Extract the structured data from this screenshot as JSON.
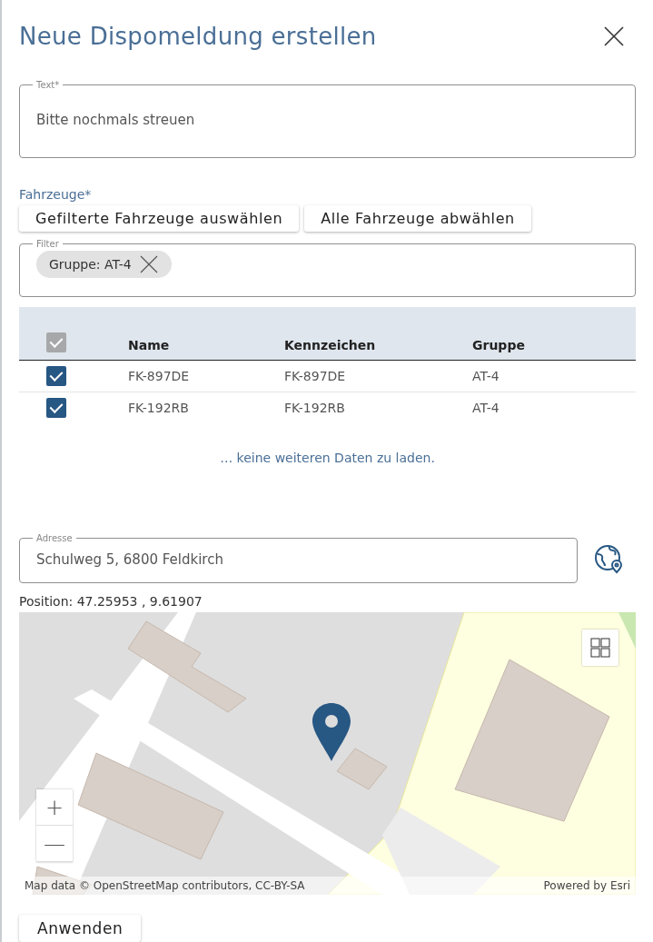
{
  "dialog": {
    "title": "Neue Dispomeldung erstellen"
  },
  "text_field": {
    "label": "Text*",
    "value": "Bitte nochmals streuen"
  },
  "vehicles": {
    "label": "Fahrzeuge*",
    "buttons": [
      "Gefilterte Fahrzeuge auswählen",
      "Alle Fahrzeuge abwählen"
    ]
  },
  "filter_field": {
    "label": "Filter",
    "chips": [
      "Gruppe: AT-4"
    ]
  },
  "table": {
    "header_checkbox": {
      "checked": true,
      "disabled": true
    },
    "columns": [
      "Name",
      "Kennzeichen",
      "Gruppe"
    ],
    "rows": [
      {
        "checked": true,
        "cells": [
          "FK-897DE",
          "FK-897DE",
          "AT-4"
        ]
      },
      {
        "checked": true,
        "cells": [
          "FK-192RB",
          "FK-192RB",
          "AT-4"
        ]
      }
    ],
    "footer": "… keine weiteren Daten zu laden."
  },
  "address_field": {
    "label": "Adresse",
    "value": "Schulweg 5, 6800 Feldkirch"
  },
  "position": "Position: 47.25953 , 9.61907",
  "map": {
    "kind": "picture",
    "attribution": "Map data © OpenStreetMap contributors, CC-BY-SA",
    "powered_by": "Powered by Esri",
    "zoom_in": "+",
    "zoom_out": "—"
  },
  "apply_button": "Anwenden"
}
